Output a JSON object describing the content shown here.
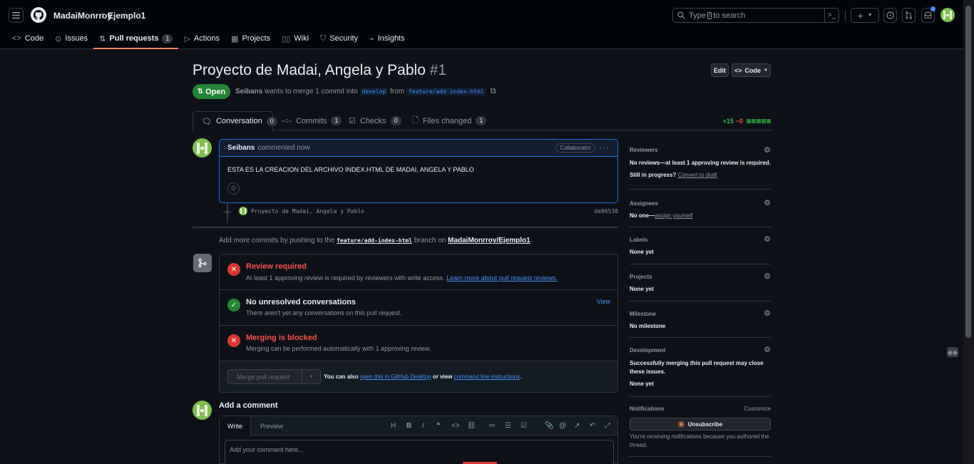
{
  "header": {
    "owner": "MadaiMonrroy",
    "separator": "/",
    "repo": "Ejemplo1",
    "search_prefix": "Type",
    "search_key": "/",
    "search_suffix": "to search",
    "plus_icon": "+"
  },
  "repo_nav": {
    "items": [
      {
        "label": "Code",
        "icon": "code-icon"
      },
      {
        "label": "Issues",
        "icon": "issue-icon"
      },
      {
        "label": "Pull requests",
        "icon": "pr-icon",
        "count": "1"
      },
      {
        "label": "Actions",
        "icon": "play-icon"
      },
      {
        "label": "Projects",
        "icon": "table-icon"
      },
      {
        "label": "Wiki",
        "icon": "book-icon"
      },
      {
        "label": "Security",
        "icon": "shield-icon"
      },
      {
        "label": "Insights",
        "icon": "graph-icon"
      }
    ]
  },
  "pr": {
    "title": "Proyecto de Madai, Angela y Pablo",
    "number": "#1",
    "edit_label": "Edit",
    "code_label": "Code",
    "state": "Open",
    "author": "Seibans",
    "meta_mid": "wants to merge 1 commit into",
    "base_branch": "develop",
    "meta_from": "from",
    "head_branch": "feature/add-index-html"
  },
  "tabs": [
    {
      "label": "Conversation",
      "count": "0"
    },
    {
      "label": "Commits",
      "count": "1"
    },
    {
      "label": "Checks",
      "count": "0"
    },
    {
      "label": "Files changed",
      "count": "1"
    }
  ],
  "diffstat": {
    "additions": "+15",
    "deletions": "−0"
  },
  "comment": {
    "author": "Seibans",
    "action": "commented now",
    "badge": "Collaborator",
    "body": "ESTA ES LA CREACION DEL ARCHIVO INDEX.HTML DE MADAI, ANGELA Y PABLO"
  },
  "commit": {
    "message": "Proyecto de Madai, Angela y Pablo",
    "sha": "de96538"
  },
  "push_hint": {
    "prefix": "Add more commits by pushing to the",
    "branch": "feature/add-index-html",
    "mid": "branch on",
    "repo": "MadaiMonrroy/Ejemplo1",
    "suffix": "."
  },
  "merge": {
    "review_title": "Review required",
    "review_desc": "At least 1 approving review is required by reviewers with write access.",
    "review_link": "Learn more about pull request reviews.",
    "conv_title": "No unresolved conversations",
    "conv_desc": "There aren't yet any conversations on this pull request.",
    "conv_view": "View",
    "blocked_title": "Merging is blocked",
    "blocked_desc": "Merging can be performed automatically with 1 approving review.",
    "merge_button": "Merge pull request",
    "also_prefix": "You can also",
    "desktop_link": "open this in GitHub Desktop",
    "or_view": "or view",
    "cli_link": "command line instructions",
    "period": "."
  },
  "add_comment": {
    "title": "Add a comment",
    "write_tab": "Write",
    "preview_tab": "Preview",
    "placeholder": "Add your comment here..."
  },
  "sidebar": {
    "reviewers": {
      "label": "Reviewers",
      "text": "No reviews—at least 1 approving review is required.",
      "progress": "Still in progress?",
      "draft_link": "Convert to draft"
    },
    "assignees": {
      "label": "Assignees",
      "text": "No one—",
      "link": "assign yourself"
    },
    "labels": {
      "label": "Labels",
      "text": "None yet"
    },
    "projects": {
      "label": "Projects",
      "text": "None yet"
    },
    "milestone": {
      "label": "Milestone",
      "text": "No milestone"
    },
    "development": {
      "label": "Development",
      "text": "Successfully merging this pull request may close these issues.",
      "none": "None yet"
    },
    "notifications": {
      "label": "Notifications",
      "customize": "Customize",
      "button": "Unsubscribe",
      "reason": "You're receiving notifications because you authored the thread."
    }
  },
  "colors": {
    "accent": "#1f6feb",
    "open": "#238636",
    "danger": "#da3633",
    "bg": "#0d1117"
  }
}
